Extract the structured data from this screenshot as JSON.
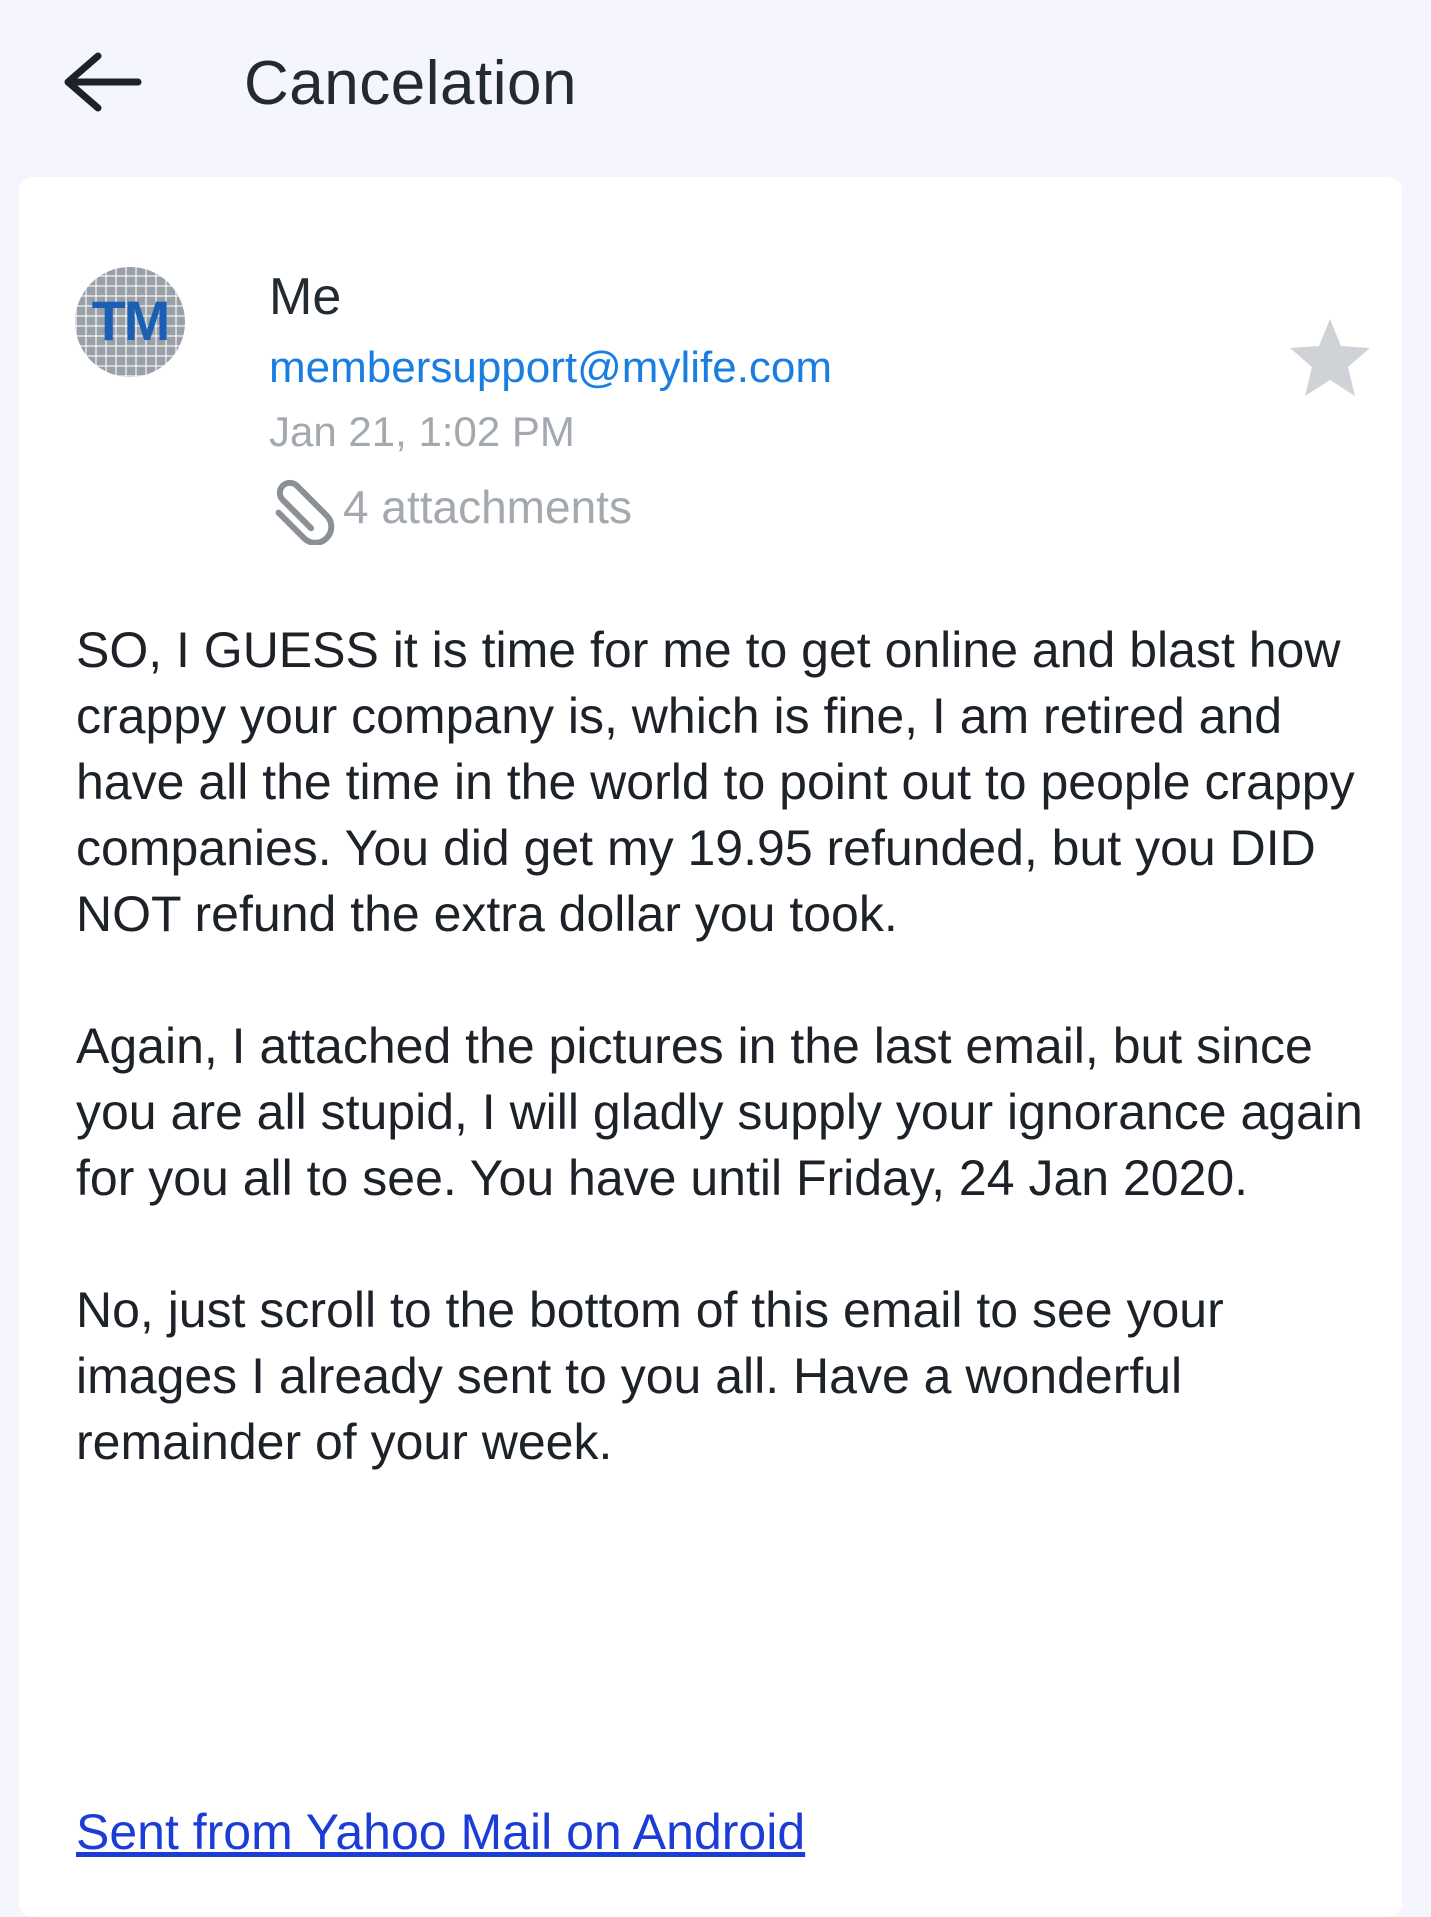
{
  "header": {
    "title": "Cancelation",
    "back_icon": "back-arrow-icon"
  },
  "message": {
    "avatar_initials": "TM",
    "sender": "Me",
    "recipient": "membersupport@mylife.com",
    "date": "Jan 21, 1:02 PM",
    "attachments_label": "4 attachments",
    "starred": false,
    "paragraphs": [
      "SO, I GUESS it is time for me to get online and blast how crappy your company is, which is fine, I am retired and have all the time in the world to point out to people crappy companies. You did get my 19.95 refunded, but you DID NOT refund the extra dollar you took.",
      "Again, I attached the pictures in the last email, but since you are all stupid, I will gladly supply your ignorance again for you all to see. You have until Friday, 24 Jan 2020.",
      "No, just scroll to the bottom of this email to see your images I already sent to you all. Have a wonderful remainder of your week."
    ],
    "signature": "Sent from Yahoo Mail on Android"
  },
  "colors": {
    "background": "#f5f6fd",
    "link_blue": "#1a7ee0",
    "signature_blue": "#1c3cd6",
    "meta_gray": "#a3a9ae",
    "star_gray": "#cfd3d8"
  }
}
